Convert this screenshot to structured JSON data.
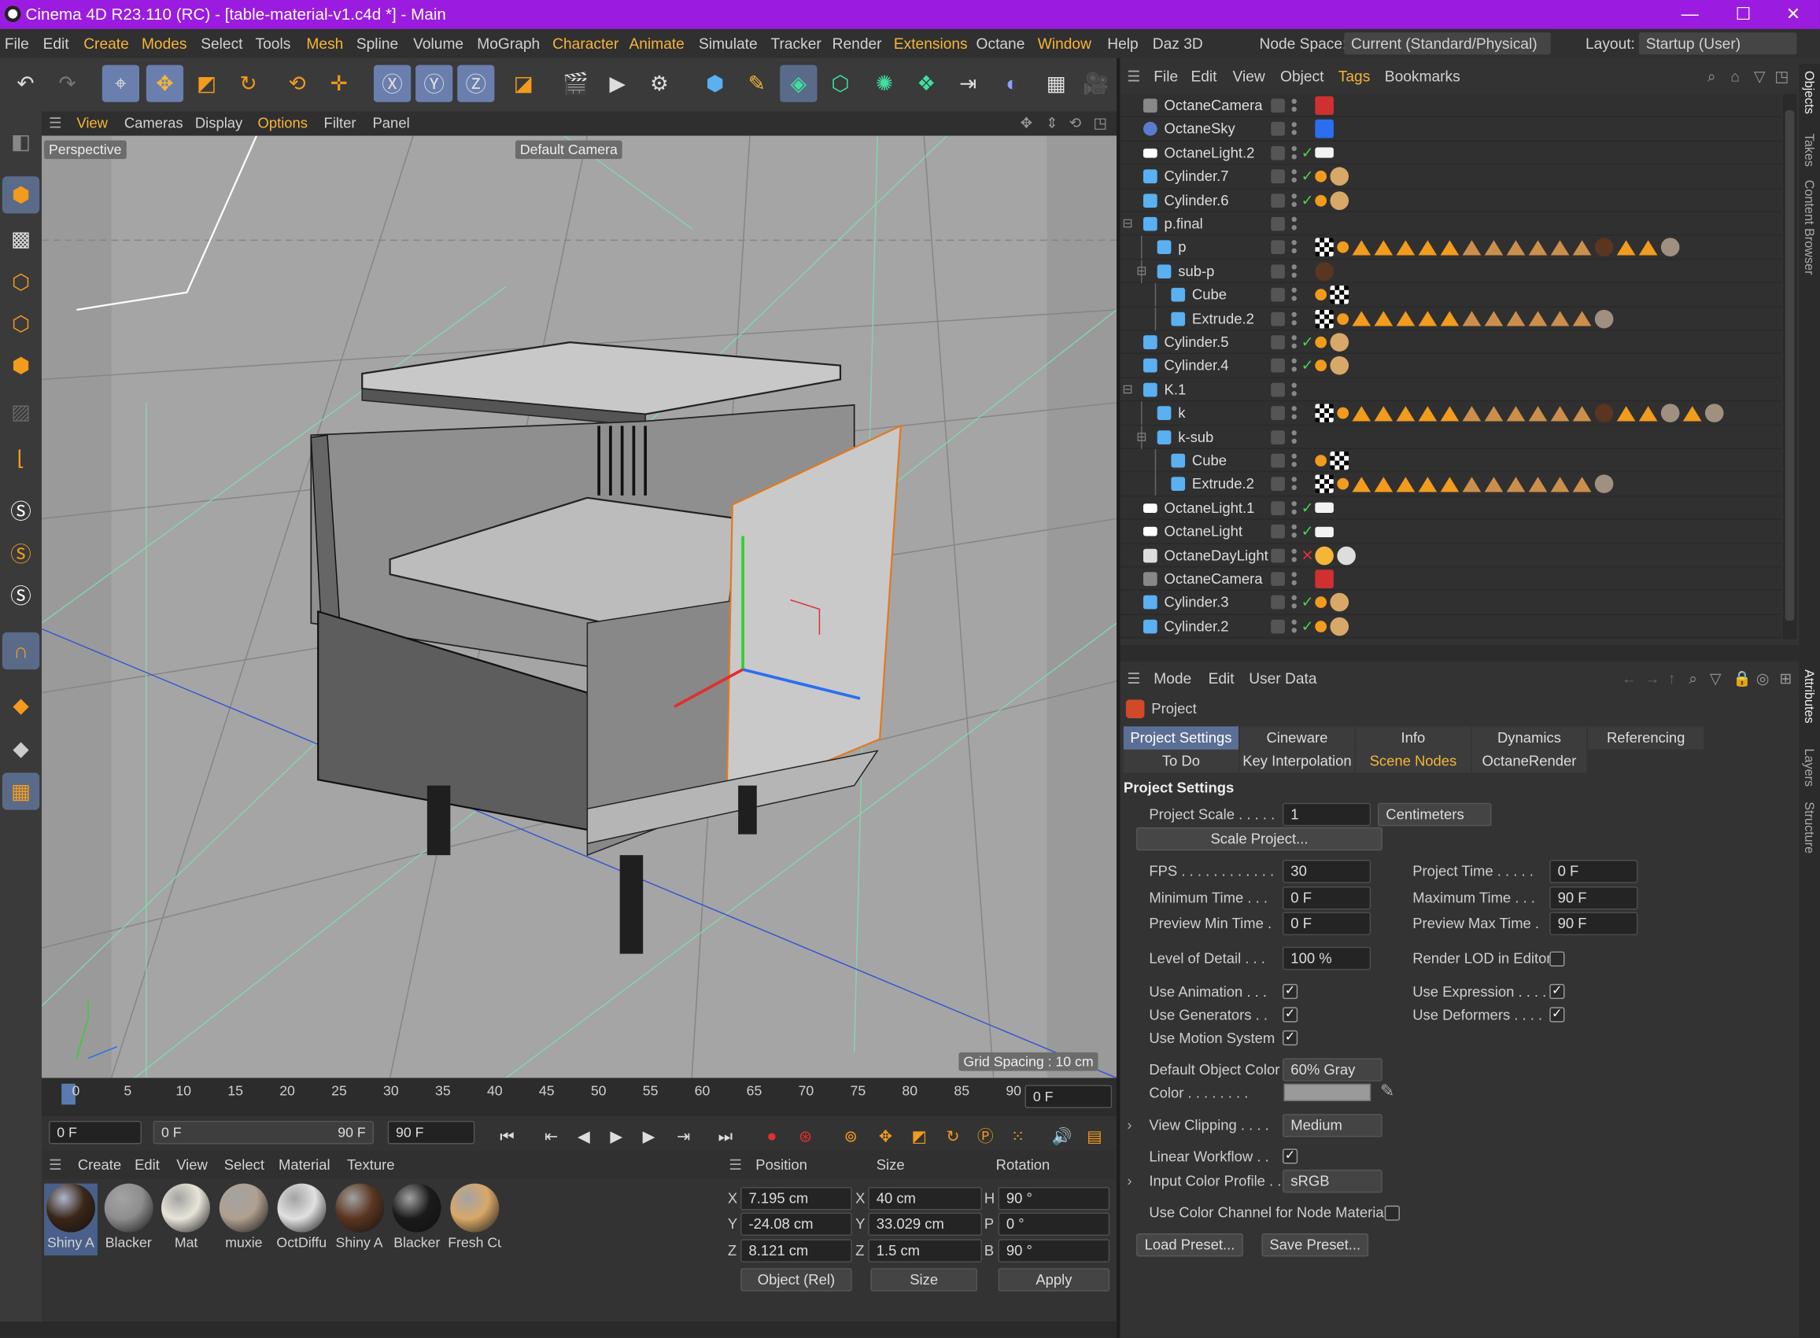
{
  "title": {
    "app": "Cinema 4D R23.110 (RC) - [table-material-v1.c4d *] - Main",
    "min": "—",
    "max": "☐",
    "close": "✕"
  },
  "menu": {
    "file": "File",
    "edit": "Edit",
    "create": "Create",
    "modes": "Modes",
    "select": "Select",
    "tools": "Tools",
    "mesh": "Mesh",
    "spline": "Spline",
    "volume": "Volume",
    "mograph": "MoGraph",
    "character": "Character",
    "animate": "Animate",
    "simulate": "Simulate",
    "tracker": "Tracker",
    "render": "Render",
    "extensions": "Extensions",
    "octane": "Octane",
    "window": "Window",
    "help": "Help",
    "daz": "Daz 3D",
    "nodespace_label": "Node Space:",
    "nodespace_value": "Current (Standard/Physical)",
    "layout_label": "Layout:",
    "layout_value": "Startup (User)"
  },
  "viewport": {
    "menu": {
      "view": "View",
      "cameras": "Cameras",
      "display": "Display",
      "options": "Options",
      "filter": "Filter",
      "panel": "Panel"
    },
    "label": "Perspective",
    "camera": "Default Camera",
    "grid": "Grid Spacing : 10 cm"
  },
  "timeline": {
    "ticks": [
      "0",
      "5",
      "10",
      "15",
      "20",
      "25",
      "30",
      "35",
      "40",
      "45",
      "50",
      "55",
      "60",
      "65",
      "70",
      "75",
      "80",
      "85",
      "90"
    ],
    "current": "0 F"
  },
  "transport": {
    "start": "0 F",
    "range_start": "0 F",
    "range_end": "90 F",
    "end": "90 F"
  },
  "materials": {
    "menu": {
      "create": "Create",
      "edit": "Edit",
      "view": "View",
      "select": "Select",
      "material": "Material",
      "texture": "Texture"
    },
    "items": [
      {
        "name": "Shiny A",
        "color": "#3a2618"
      },
      {
        "name": "Blacker",
        "color": "#8e8e8e"
      },
      {
        "name": "Mat",
        "color": "#e8e4d8"
      },
      {
        "name": "muxie",
        "color": "#b0a090"
      },
      {
        "name": "OctDiffu",
        "color": "#e0e0e0"
      },
      {
        "name": "Shiny A",
        "color": "#5a3520"
      },
      {
        "name": "Blacker",
        "color": "#1a1a1a"
      },
      {
        "name": "Fresh Cu",
        "color": "#d8a868"
      }
    ]
  },
  "coords": {
    "hdr": {
      "position": "Position",
      "size": "Size",
      "rotation": "Rotation"
    },
    "px": "7.195 cm",
    "py": "-24.08 cm",
    "pz": "8.121 cm",
    "sx": "40 cm",
    "sy": "33.029 cm",
    "sz": "1.5 cm",
    "rh": "90 °",
    "rp": "0 °",
    "rb": "90 °",
    "lx": "X",
    "ly": "Y",
    "lz": "Z",
    "lh": "H",
    "lp": "P",
    "lb": "B",
    "mode": "Object (Rel)",
    "sizemode": "Size",
    "apply": "Apply"
  },
  "objects": {
    "menu": {
      "file": "File",
      "edit": "Edit",
      "view": "View",
      "object": "Object",
      "tags": "Tags",
      "bookmarks": "Bookmarks"
    },
    "rows": [
      {
        "name": "OctaneCamera",
        "indent": 0,
        "icon": "camera"
      },
      {
        "name": "OctaneSky",
        "indent": 0,
        "icon": "sky"
      },
      {
        "name": "OctaneLight.2",
        "indent": 0,
        "icon": "light"
      },
      {
        "name": "Cylinder.7",
        "indent": 0,
        "icon": "cyl"
      },
      {
        "name": "Cylinder.6",
        "indent": 0,
        "icon": "cyl"
      },
      {
        "name": "p.final",
        "indent": 0,
        "icon": "null"
      },
      {
        "name": "p",
        "indent": 1,
        "icon": "poly"
      },
      {
        "name": "sub-p",
        "indent": 1,
        "icon": "null"
      },
      {
        "name": "Cube",
        "indent": 2,
        "icon": "poly"
      },
      {
        "name": "Extrude.2",
        "indent": 2,
        "icon": "poly"
      },
      {
        "name": "Cylinder.5",
        "indent": 0,
        "icon": "cyl"
      },
      {
        "name": "Cylinder.4",
        "indent": 0,
        "icon": "cyl"
      },
      {
        "name": "K.1",
        "indent": 0,
        "icon": "null"
      },
      {
        "name": "k",
        "indent": 1,
        "icon": "poly"
      },
      {
        "name": "k-sub",
        "indent": 1,
        "icon": "null"
      },
      {
        "name": "Cube",
        "indent": 2,
        "icon": "poly"
      },
      {
        "name": "Extrude.2",
        "indent": 2,
        "icon": "poly"
      },
      {
        "name": "OctaneLight.1",
        "indent": 0,
        "icon": "light"
      },
      {
        "name": "OctaneLight",
        "indent": 0,
        "icon": "light"
      },
      {
        "name": "OctaneDayLight",
        "indent": 0,
        "icon": "day"
      },
      {
        "name": "OctaneCamera",
        "indent": 0,
        "icon": "camera"
      },
      {
        "name": "Cylinder.3",
        "indent": 0,
        "icon": "cyl"
      },
      {
        "name": "Cylinder.2",
        "indent": 0,
        "icon": "cyl"
      }
    ]
  },
  "attributes": {
    "menu": {
      "mode": "Mode",
      "edit": "Edit",
      "userdata": "User Data"
    },
    "project": "Project",
    "tabs1": [
      "Project Settings",
      "Cineware",
      "Info",
      "Dynamics",
      "Referencing"
    ],
    "tabs2": [
      "To Do",
      "Key Interpolation",
      "Scene Nodes",
      "OctaneRender"
    ],
    "section": "Project Settings",
    "scale_label": "Project Scale . . . . .",
    "scale_value": "1",
    "scale_unit": "Centimeters",
    "scale_btn": "Scale Project...",
    "fps_label": "FPS . . . . . . . . . . . .",
    "fps_value": "30",
    "ptime_label": "Project Time . . . . .",
    "ptime_value": "0 F",
    "mintime_label": "Minimum Time . . .",
    "mintime_value": "0 F",
    "maxtime_label": "Maximum Time . . .",
    "maxtime_value": "90 F",
    "pmin_label": "Preview Min Time .",
    "pmin_value": "0 F",
    "pmax_label": "Preview Max Time .",
    "pmax_value": "90 F",
    "lod_label": "Level of Detail . . .",
    "lod_value": "100 %",
    "rlod_label": "Render LOD in Editor",
    "useanim": "Use Animation . . .",
    "useexpr": "Use Expression . . . .",
    "usegen": "Use Generators . .",
    "usedef": "Use Deformers . . . .",
    "usemotion": "Use Motion System",
    "defcolor_label": "Default Object Color",
    "defcolor_value": "60% Gray",
    "color_label": "Color . . . . . . . .",
    "clip_label": "View Clipping . . . .",
    "clip_value": "Medium",
    "linear_label": "Linear Workflow . .",
    "profile_label": "Input Color Profile . .",
    "profile_value": "sRGB",
    "nodemat_label": "Use Color Channel for Node Material",
    "load": "Load Preset...",
    "save": "Save Preset..."
  },
  "side": {
    "objects": "Objects",
    "takes": "Takes",
    "content": "Content Browser",
    "attributes": "Attributes",
    "layers": "Layers",
    "structure": "Structure"
  }
}
